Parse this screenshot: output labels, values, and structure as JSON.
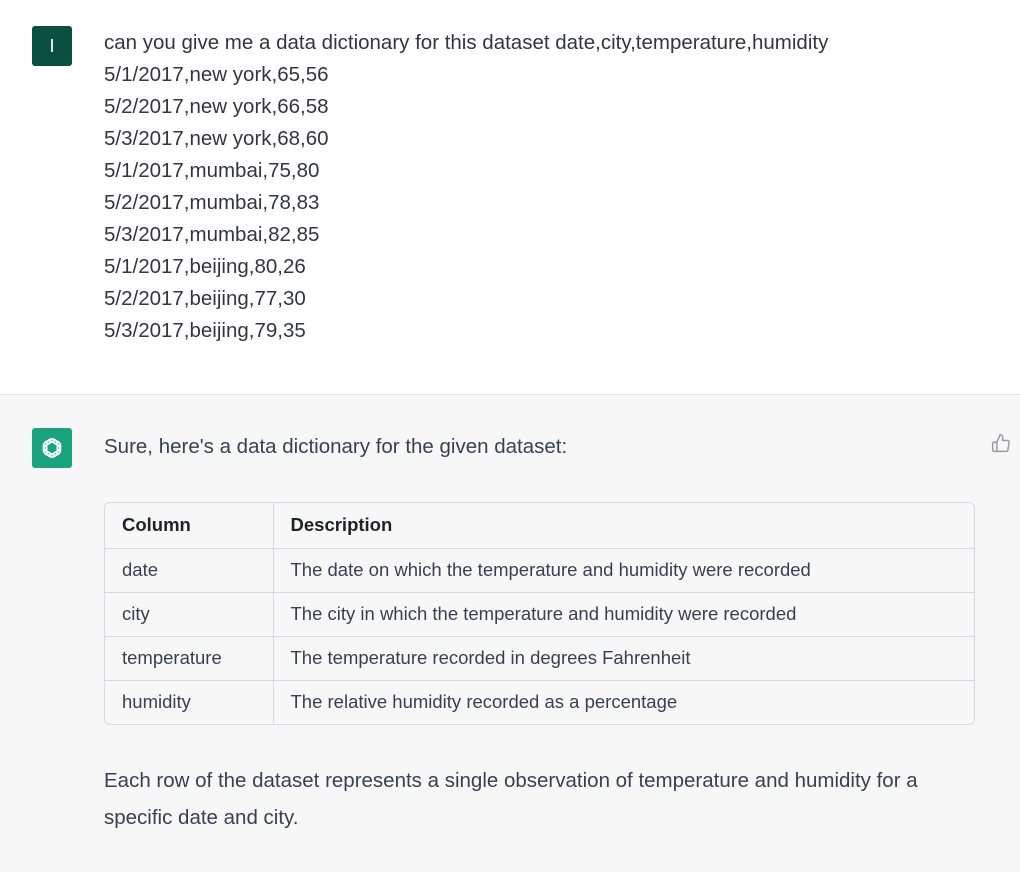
{
  "user": {
    "avatar_initial": "I",
    "avatar_color": "#0b4f3f",
    "message": "can you give me a data dictionary for this dataset date,city,temperature,humidity\n5/1/2017,new york,65,56\n5/2/2017,new york,66,58\n5/3/2017,new york,68,60\n5/1/2017,mumbai,75,80\n5/2/2017,mumbai,78,83\n5/3/2017,mumbai,82,85\n5/1/2017,beijing,80,26\n5/2/2017,beijing,77,30\n5/3/2017,beijing,79,35"
  },
  "assistant": {
    "avatar_icon": "openai-logo-icon",
    "avatar_color": "#19a37f",
    "intro": "Sure, here's a data dictionary for the given dataset:",
    "feedback_icon": "thumbs-up-icon",
    "table": {
      "headers": [
        "Column",
        "Description"
      ],
      "rows": [
        [
          "date",
          "The date on which the temperature and humidity were recorded"
        ],
        [
          "city",
          "The city in which the temperature and humidity were recorded"
        ],
        [
          "temperature",
          "The temperature recorded in degrees Fahrenheit"
        ],
        [
          "humidity",
          "The relative humidity recorded as a percentage"
        ]
      ]
    },
    "outro": "Each row of the dataset represents a single observation of temperature and humidity for a specific date and city."
  }
}
